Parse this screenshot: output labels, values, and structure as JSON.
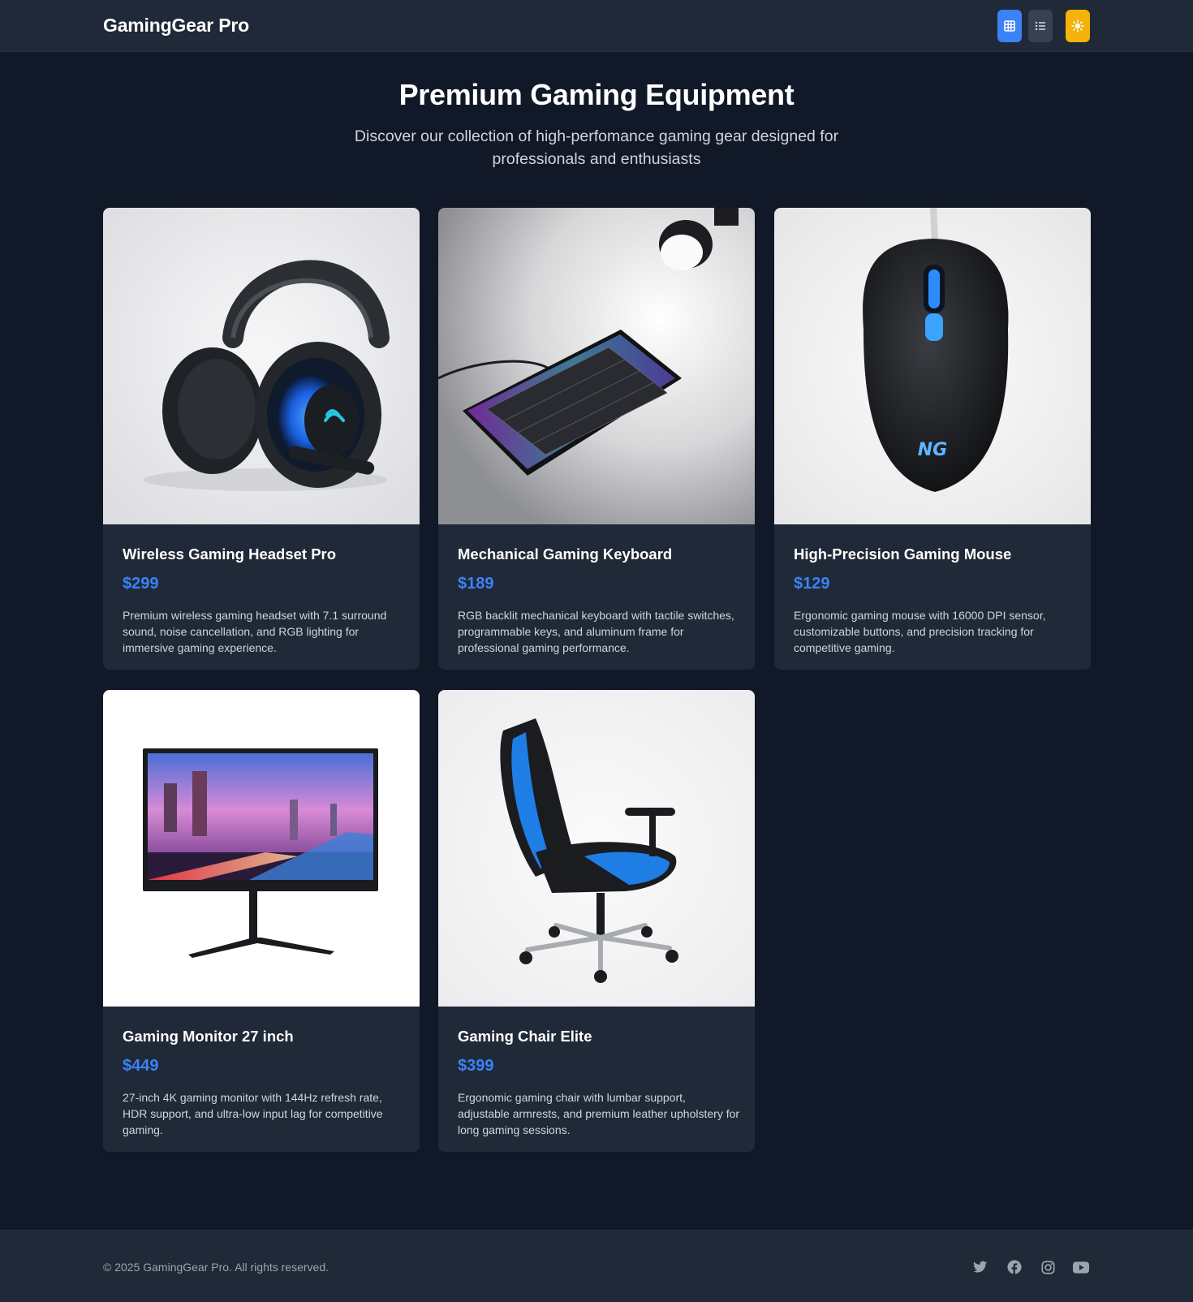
{
  "header": {
    "brand": "GamingGear Pro",
    "view_buttons": [
      {
        "name": "grid-view",
        "icon": "grid-icon",
        "active": true
      },
      {
        "name": "list-view",
        "icon": "list-icon",
        "active": false
      }
    ],
    "theme_toggle_icon": "sun-icon"
  },
  "hero": {
    "title": "Premium Gaming Equipment",
    "subtitle": "Discover our collection of high-perfomance gaming gear designed for professionals and enthusiasts"
  },
  "products": [
    {
      "name": "Wireless Gaming Headset Pro",
      "price": "$299",
      "description": "Premium wireless gaming headset with 7.1 surround sound, noise cancellation, and RGB lighting for immersive gaming experience.",
      "image": "headset"
    },
    {
      "name": "Mechanical Gaming Keyboard",
      "price": "$189",
      "description": "RGB backlit mechanical keyboard with tactile switches, programmable keys, and aluminum frame for professional gaming performance.",
      "image": "keyboard"
    },
    {
      "name": "High-Precision Gaming Mouse",
      "price": "$129",
      "description": "Ergonomic gaming mouse with 16000 DPI sensor, customizable buttons, and precision tracking for competitive gaming.",
      "image": "mouse"
    },
    {
      "name": "Gaming Monitor 27 inch",
      "price": "$449",
      "description": "27-inch 4K gaming monitor with 144Hz refresh rate, HDR support, and ultra-low input lag for competitive gaming.",
      "image": "monitor"
    },
    {
      "name": "Gaming Chair Elite",
      "price": "$399",
      "description": "Ergonomic gaming chair with lumbar support, adjustable armrests, and premium leather upholstery for long gaming sessions.",
      "image": "chair"
    }
  ],
  "footer": {
    "copyright": "© 2025 GamingGear Pro. All rights reserved.",
    "social": [
      "twitter-icon",
      "facebook-icon",
      "instagram-icon",
      "youtube-icon"
    ]
  },
  "colors": {
    "background": "#111827",
    "surface": "#1f2937",
    "accent": "#3b82f6",
    "theme_button": "#f5b20b",
    "muted_text": "#d1d5db"
  }
}
